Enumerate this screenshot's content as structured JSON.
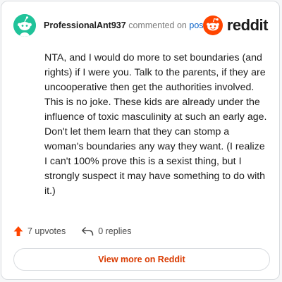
{
  "comment": {
    "username": "ProfessionalAnt937",
    "action_text": "commented on",
    "post_link": "post",
    "body": "NTA, and I would do more to set boundaries (and rights) if I were you. Talk to the parents, if they are uncooperative then get the authorities involved. This is no joke. These kids are already under the influence of toxic masculinity at such an early age. Don't let them learn that they can stomp a woman's boundaries any way they want. (I realize I can't 100% prove this is a sexist thing, but I strongly suspect it may have something to do with it.)",
    "upvotes_label": "7 upvotes",
    "replies_label": "0 replies"
  },
  "brand": {
    "name": "reddit",
    "color": "#ff4500"
  },
  "avatar": {
    "background": "#20c39a",
    "icon": "snoo-avatar-icon"
  },
  "footer": {
    "view_more_label": "View more on Reddit"
  },
  "icons": {
    "upvote": "upvote-arrow-icon",
    "reply": "reply-arrow-icon"
  }
}
